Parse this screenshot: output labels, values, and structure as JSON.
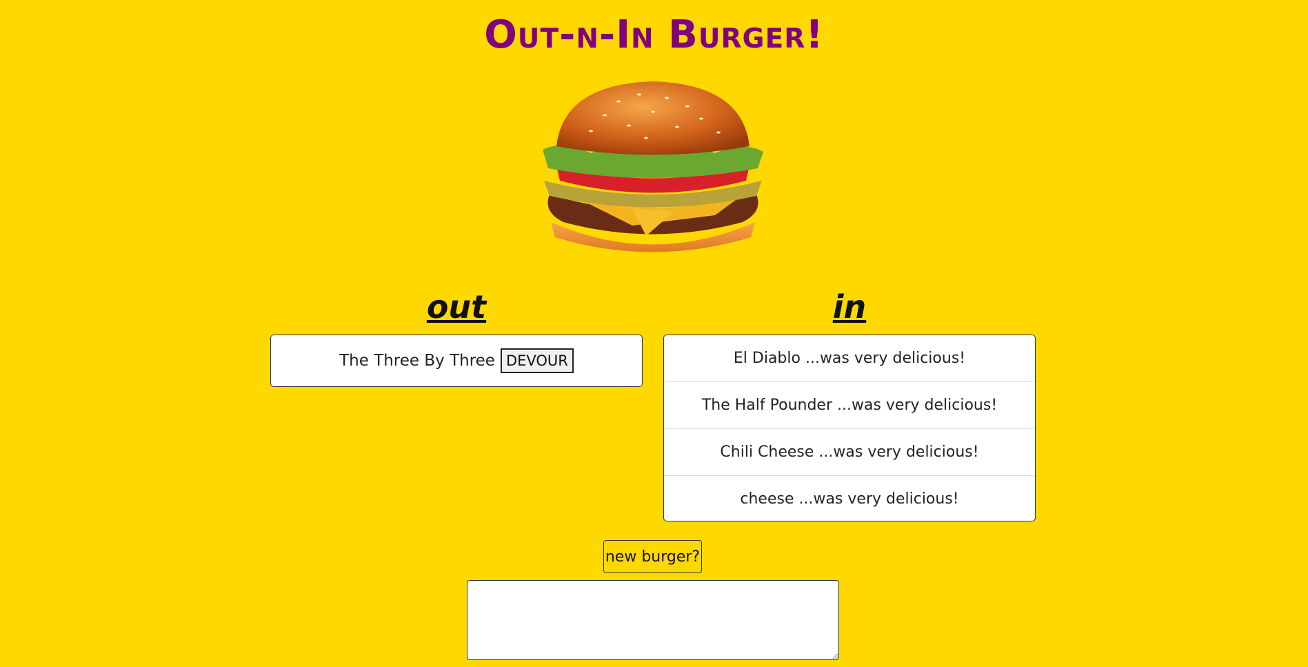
{
  "header": {
    "title": "Out-n-In Burger!"
  },
  "hero": {
    "image": "burger-illustration"
  },
  "columns": {
    "out_heading": "out",
    "in_heading": "in"
  },
  "out_list": [
    {
      "name": "The Three By Three",
      "button_label": "DEVOUR"
    }
  ],
  "in_list": [
    {
      "text": "El Diablo ...was very delicious!"
    },
    {
      "text": "The Half Pounder ...was very delicious!"
    },
    {
      "text": "Chili Cheese ...was very delicious!"
    },
    {
      "text": "cheese ...was very delicious!"
    }
  ],
  "form": {
    "submit_label": "new burger?",
    "input_value": ""
  },
  "colors": {
    "background": "#FFD800",
    "title": "#800080"
  }
}
